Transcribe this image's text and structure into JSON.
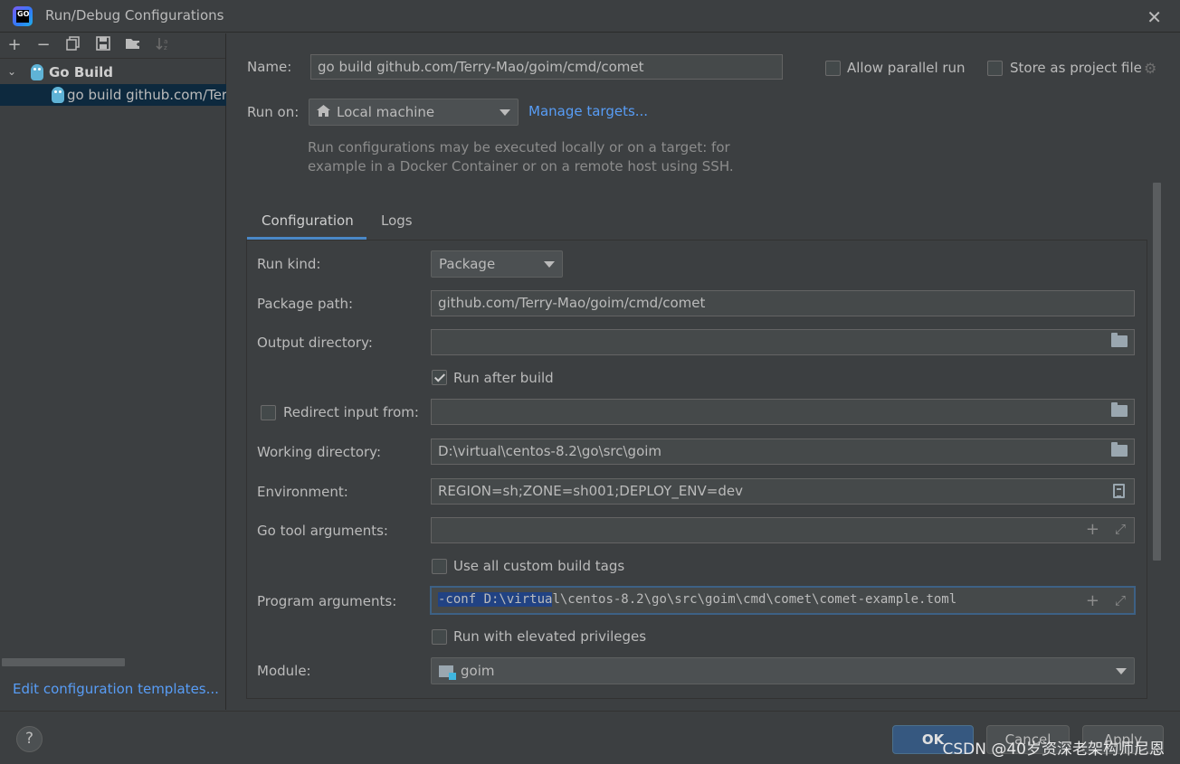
{
  "window": {
    "title": "Run/Debug Configurations",
    "app_icon_text": "GO"
  },
  "sidebar": {
    "toolbar": [
      "add-icon",
      "remove-icon",
      "copy-icon",
      "save-icon",
      "new-folder-icon",
      "sort-icon"
    ],
    "group_label": "Go Build",
    "item_label": "go build github.com/Terr",
    "edit_templates": "Edit configuration templates..."
  },
  "form": {
    "name_label": "Name:",
    "name_value": "go build github.com/Terry-Mao/goim/cmd/comet",
    "allow_parallel_label": "Allow parallel run",
    "store_project_label": "Store as project file",
    "run_on_label": "Run on:",
    "run_on_value": "Local machine",
    "manage_targets": "Manage targets...",
    "hint_line1": "Run configurations may be executed locally or on a target: for",
    "hint_line2": "example in a Docker Container or on a remote host using SSH."
  },
  "tabs": {
    "configuration": "Configuration",
    "logs": "Logs"
  },
  "config": {
    "run_kind_label": "Run kind:",
    "run_kind_value": "Package",
    "package_path_label": "Package path:",
    "package_path_value": "github.com/Terry-Mao/goim/cmd/comet",
    "output_dir_label": "Output directory:",
    "output_dir_value": "",
    "run_after_build_label": "Run after build",
    "run_after_build_checked": true,
    "redirect_input_label": "Redirect input from:",
    "redirect_input_value": "",
    "working_dir_label": "Working directory:",
    "working_dir_value": "D:\\virtual\\centos-8.2\\go\\src\\goim",
    "environment_label": "Environment:",
    "environment_value": "REGION=sh;ZONE=sh001;DEPLOY_ENV=dev",
    "go_tool_args_label": "Go tool arguments:",
    "go_tool_args_value": "",
    "custom_build_tags_label": "Use all custom build tags",
    "program_args_label": "Program arguments:",
    "program_args_selected": "-conf D:\\virtua",
    "program_args_rest": "l\\centos-8.2\\go\\src\\goim\\cmd\\comet\\comet-example.toml",
    "elevated_label": "Run with elevated privileges",
    "module_label": "Module:",
    "module_value": "goim"
  },
  "footer": {
    "help": "?",
    "ok": "OK",
    "cancel": "Cancel",
    "apply": "Apply",
    "watermark": "CSDN @40岁资深老架构师尼恩"
  },
  "colors": {
    "background": "#3c3f41",
    "accent": "#589df6",
    "selection": "#0d293e",
    "primary_button": "#365880"
  }
}
